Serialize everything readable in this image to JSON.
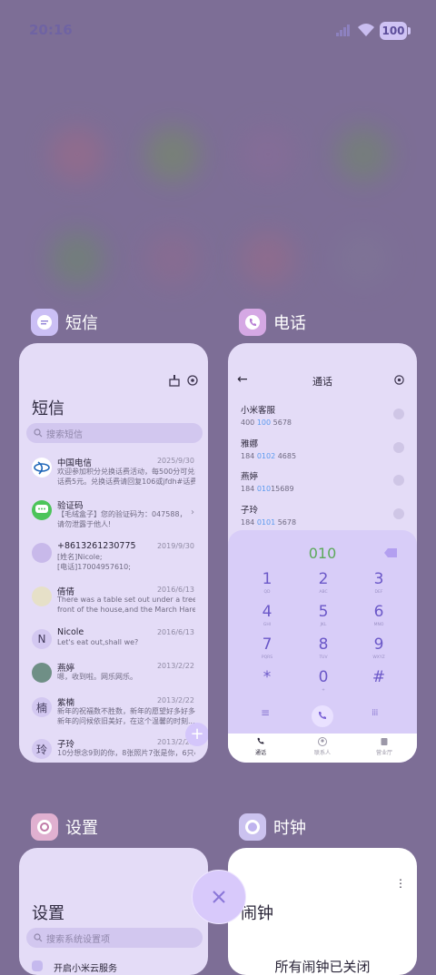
{
  "status_bar": {
    "time": "20:16",
    "battery": "100"
  },
  "apps": [
    {
      "name": "短信"
    },
    {
      "name": "电话"
    },
    {
      "name": "设置"
    },
    {
      "name": "时钟"
    }
  ],
  "sms": {
    "title": "短信",
    "search_placeholder": "搜索短信",
    "items": [
      {
        "name": "中国电信",
        "date": "2025/9/30",
        "l1": "欢迎参加积分兑换话费活动，每500分可兑换",
        "l2": "话费5元。兑换话费请回复106或jfdh#话费..."
      },
      {
        "name": "验证码",
        "date": "",
        "l1": "【毛绒盒子】您的验证码为：047588，",
        "l2": "请勿泄露于他人!"
      },
      {
        "name": "+8613261230775",
        "date": "2019/9/30",
        "l1": "[姓名]Nicole;",
        "l2": "[电话]17004957610;"
      },
      {
        "name": "倩倩",
        "date": "2016/6/13",
        "l1": "There was a table set out under a tree in",
        "l2": "front of the house,and the March Hare an..."
      },
      {
        "name": "Nicole",
        "date": "2016/6/13",
        "l1": "Let's eat out,shall we?",
        "l2": "",
        "avatar": "N"
      },
      {
        "name": "燕婷",
        "date": "2013/2/22",
        "l1": "嗯，收到啦。网乐网乐。",
        "l2": ""
      },
      {
        "name": "紫楠",
        "date": "2013/2/22",
        "l1": "新年的祝福数不胜数，新年的愿望好多好多，",
        "l2": "新年的问候依旧美好，在这个温馨的时刻...",
        "avatar": "楠"
      },
      {
        "name": "子玲",
        "date": "2013/2/22",
        "l1": "10分想念9到的你，8张照片7张是你，6只小",
        "l2": "",
        "avatar": "玲"
      }
    ]
  },
  "phone": {
    "title": "通话",
    "contacts": [
      {
        "name": "小米客服",
        "num_a": "400 ",
        "num_hl": "100",
        "num_b": " 5678"
      },
      {
        "name": "雅娜",
        "num_a": "184 ",
        "num_hl": "0102",
        "num_b": " 4685"
      },
      {
        "name": "燕婷",
        "num_a": "184 ",
        "num_hl": "010",
        "num_b": "15689"
      },
      {
        "name": "子玲",
        "num_a": "184 ",
        "num_hl": "0101",
        "num_b": " 5678"
      }
    ],
    "dialed": "010",
    "keys": [
      {
        "d": "1",
        "s": "QD"
      },
      {
        "d": "2",
        "s": "ABC"
      },
      {
        "d": "3",
        "s": "DEF"
      },
      {
        "d": "4",
        "s": "GHI"
      },
      {
        "d": "5",
        "s": "JKL"
      },
      {
        "d": "6",
        "s": "MNO"
      },
      {
        "d": "7",
        "s": "PQRS"
      },
      {
        "d": "8",
        "s": "TUV"
      },
      {
        "d": "9",
        "s": "WXYZ"
      },
      {
        "d": "*",
        "s": ""
      },
      {
        "d": "0",
        "s": "+"
      },
      {
        "d": "#",
        "s": ""
      }
    ],
    "tabs": [
      "通话",
      "联系人",
      "营业厅"
    ]
  },
  "settings": {
    "title": "设置",
    "search_placeholder": "搜索系统设置项",
    "first_item": "开启小米云服务"
  },
  "clock": {
    "title": "闹钟",
    "empty_text": "所有闹钟已关闭"
  }
}
